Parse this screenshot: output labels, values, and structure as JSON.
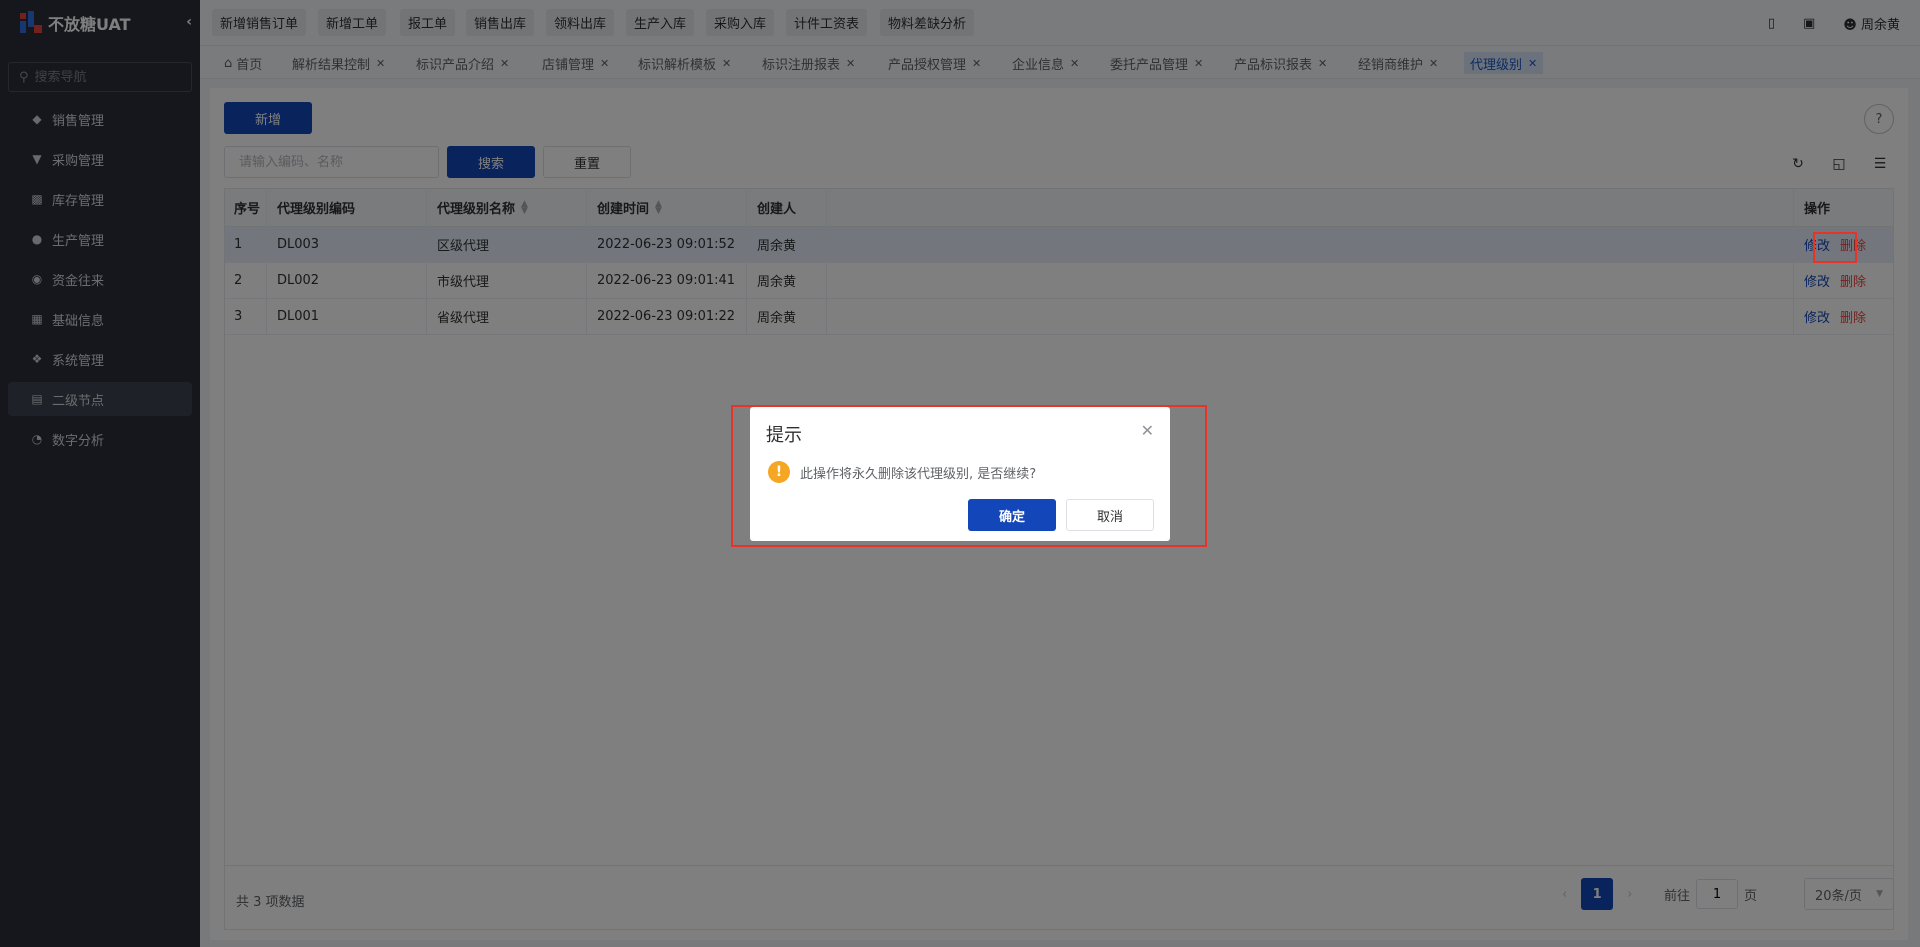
{
  "app": {
    "title": "不放糖UAT"
  },
  "sidebar": {
    "search_placeholder": "搜索导航",
    "items": [
      {
        "label": "销售管理",
        "icon": "tag-icon"
      },
      {
        "label": "采购管理",
        "icon": "cart-icon"
      },
      {
        "label": "库存管理",
        "icon": "box-icon"
      },
      {
        "label": "生产管理",
        "icon": "factory-icon"
      },
      {
        "label": "资金往来",
        "icon": "money-icon"
      },
      {
        "label": "基础信息",
        "icon": "grid-icon"
      },
      {
        "label": "系统管理",
        "icon": "settings-icon"
      },
      {
        "label": "二级节点",
        "icon": "document-icon"
      },
      {
        "label": "数字分析",
        "icon": "pie-chart-icon"
      }
    ]
  },
  "topbar": {
    "quick_links": [
      "新增销售订单",
      "新增工单",
      "报工单",
      "销售出库",
      "领料出库",
      "生产入库",
      "采购入库",
      "计件工资表",
      "物料差缺分析"
    ],
    "user": "周余黄"
  },
  "tabs": [
    {
      "label": "首页"
    },
    {
      "label": "解析结果控制"
    },
    {
      "label": "标识产品介绍"
    },
    {
      "label": "店铺管理"
    },
    {
      "label": "标识解析模板"
    },
    {
      "label": "标识注册报表"
    },
    {
      "label": "产品授权管理"
    },
    {
      "label": "企业信息"
    },
    {
      "label": "委托产品管理"
    },
    {
      "label": "产品标识报表"
    },
    {
      "label": "经销商维护"
    },
    {
      "label": "代理级别"
    }
  ],
  "toolbar": {
    "add_label": "新增",
    "search_placeholder": "请输入编码、名称",
    "search_label": "搜索",
    "reset_label": "重置"
  },
  "table": {
    "columns": [
      "序号",
      "代理级别编码",
      "代理级别名称",
      "创建时间",
      "创建人",
      "操作"
    ],
    "rows": [
      {
        "no": "1",
        "code": "DL003",
        "name": "区级代理",
        "created": "2022-06-23 09:01:52",
        "creator": "周余黄"
      },
      {
        "no": "2",
        "code": "DL002",
        "name": "市级代理",
        "created": "2022-06-23 09:01:41",
        "creator": "周余黄"
      },
      {
        "no": "3",
        "code": "DL001",
        "name": "省级代理",
        "created": "2022-06-23 09:01:22",
        "creator": "周余黄"
      }
    ],
    "edit_label": "修改",
    "delete_label": "删除"
  },
  "pagination": {
    "total_text": "共 3 项数据",
    "current_page": "1",
    "goto_label": "前往",
    "goto_value": "1",
    "page_suffix": "页",
    "page_size": "20条/页"
  },
  "dialog": {
    "title": "提示",
    "message": "此操作将永久删除该代理级别, 是否继续?",
    "confirm_label": "确定",
    "cancel_label": "取消"
  },
  "colors": {
    "primary": "#1346b8",
    "danger": "#e5453c",
    "sidebar_bg": "#2b2f3a",
    "highlight_box": "#e8332b"
  }
}
